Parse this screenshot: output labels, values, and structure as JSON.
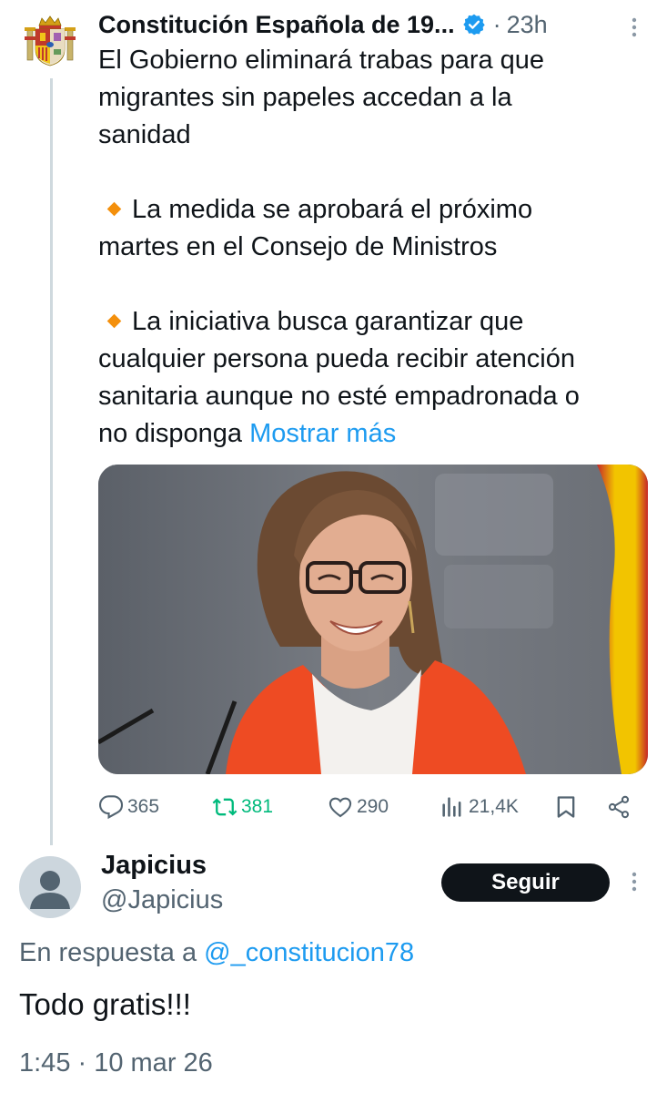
{
  "post": {
    "author_name": "Constitución Española de 19...",
    "separator": "·",
    "time": "23h",
    "text_lines": [
      "El Gobierno eliminará trabas para que",
      "migrantes sin papeles accedan a la",
      "sanidad"
    ],
    "bullet_1_lines": [
      "La medida se aprobará el próximo",
      "martes en el Consejo de Ministros"
    ],
    "bullet_2_lines": [
      "La iniciativa busca garantizar que",
      "cualquier persona pueda recibir atención",
      "sanitaria aunque no esté empadronada o",
      "no disponga "
    ],
    "show_more": "Mostrar más",
    "bullet_icon": "orange-diamond",
    "verified": true,
    "image": "photo-smiling-woman-orange-jacket-press-room"
  },
  "actions": {
    "replies": "365",
    "retweets": "381",
    "likes": "290",
    "views": "21,4K"
  },
  "reply": {
    "name": "Japicius",
    "handle": "@Japicius",
    "follow_label": "Seguir",
    "reply_to_prefix": "En respuesta a ",
    "reply_to_mention": "@_constitucion78",
    "text": "Todo gratis!!!",
    "date": "1:45 · 10 mar 26"
  },
  "colors": {
    "accent": "#1d9bf0",
    "retweet_green": "#00ba7c",
    "muted": "#536471",
    "text": "#0f1419",
    "bullet": "#f4900c"
  }
}
